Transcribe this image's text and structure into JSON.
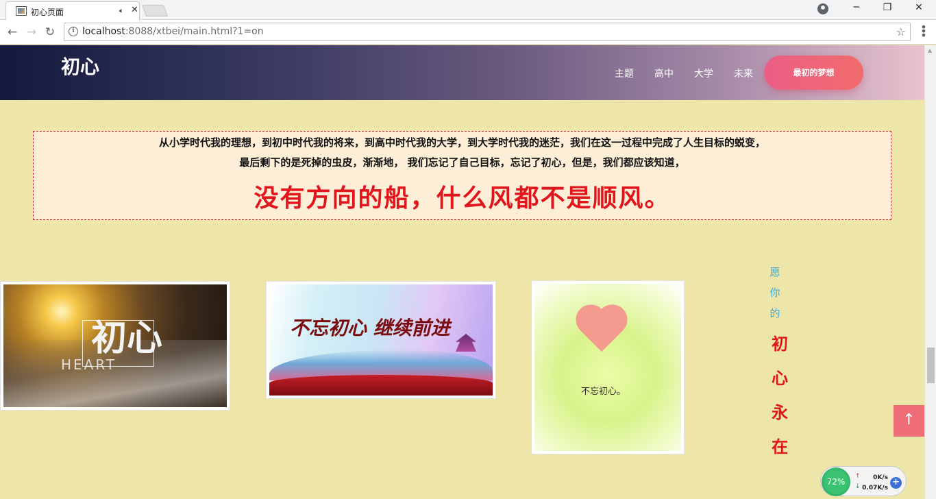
{
  "browser": {
    "tab_title": "初心页面",
    "url_host": "localhost",
    "url_rest": ":8088/xtbei/main.html?1=on",
    "icons": [
      "favicon-icon",
      "audio-icon",
      "close-icon",
      "back-icon",
      "forward-icon",
      "reload-icon",
      "info-icon",
      "star-icon",
      "menu-icon",
      "account-icon",
      "minimize-icon",
      "maximize-icon",
      "window-close-icon"
    ]
  },
  "header": {
    "logo": "初心",
    "nav": [
      "主题",
      "高中",
      "大学",
      "未来"
    ],
    "cta": "最初的梦想"
  },
  "quote": {
    "line1": "从小学时代我的理想，到初中时代我的将来，到高中时代我的大学，到大学时代我的迷茫，我们在这一过程中完成了人生目标的蜕变，",
    "line2": "最后剩下的是死掉的虫皮，渐渐地， 我们忘记了自己目标，忘记了初心，但是，我们都应该知道，",
    "highlight": "没有方向的船，什么风都不是顺风。"
  },
  "photos": {
    "p1_title": "初心",
    "p1_sub": "HEART",
    "p2_title": "不忘初心 继续前进",
    "p3_caption": "不忘初心。"
  },
  "vertical": {
    "small": [
      "愿",
      "你",
      "的"
    ],
    "big": [
      "初",
      "心",
      "永",
      "在"
    ]
  },
  "widget": {
    "percent": "72%",
    "upload": "0K/s",
    "download": "0.07K/s"
  },
  "colors": {
    "accent": "#e0161c",
    "cta": "#ec5e86",
    "page_bg": "#ede6a8"
  }
}
